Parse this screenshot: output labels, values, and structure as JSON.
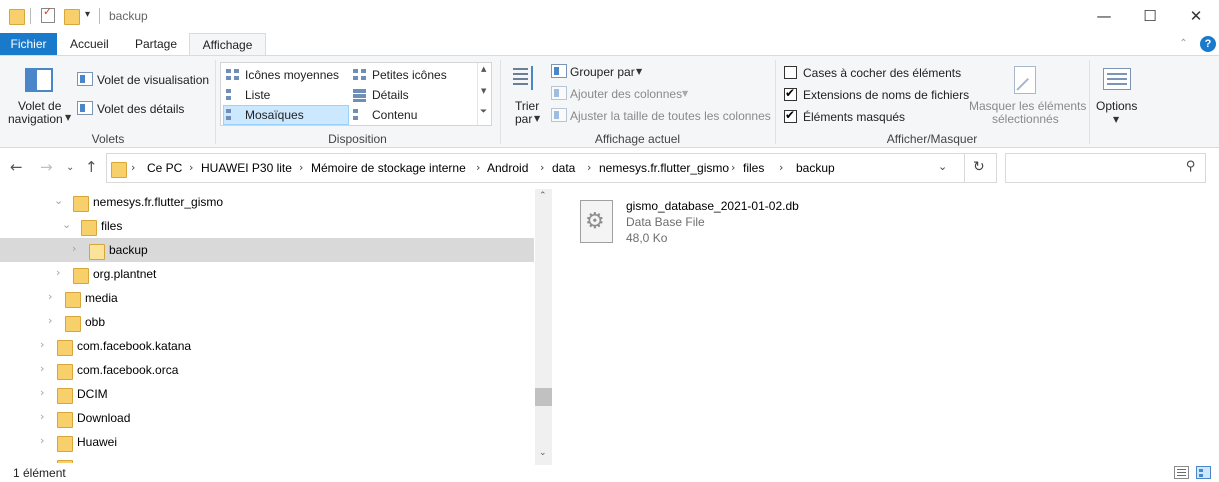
{
  "titlebar": {
    "title": "backup",
    "qat_dropdown": "▾",
    "minimize": "—",
    "maximize": "☐",
    "close": "✕"
  },
  "menu": {
    "tabs": [
      "Fichier",
      "Accueil",
      "Partage",
      "Affichage"
    ],
    "active": "Affichage",
    "help": "?"
  },
  "ribbon": {
    "volets": {
      "nav_pane_line1": "Volet de",
      "nav_pane_line2": "navigation",
      "preview": "Volet de visualisation",
      "details": "Volet des détails",
      "group": "Volets"
    },
    "disposition": {
      "items": [
        "Icônes moyennes",
        "Petites icônes",
        "Liste",
        "Détails",
        "Mosaïques",
        "Contenu"
      ],
      "selected": "Mosaïques",
      "group": "Disposition"
    },
    "affichage_actuel": {
      "sort_line1": "Trier",
      "sort_line2": "par",
      "group_by": "Grouper par",
      "add_columns": "Ajouter des colonnes",
      "fit_columns": "Ajuster la taille de toutes les colonnes",
      "group": "Affichage actuel"
    },
    "afficher_masquer": {
      "checkboxes": [
        {
          "label": "Cases à cocher des éléments",
          "checked": false
        },
        {
          "label": "Extensions de noms de fichiers",
          "checked": true
        },
        {
          "label": "Éléments masqués",
          "checked": true
        }
      ],
      "hide_selected_line1": "Masquer les éléments",
      "hide_selected_line2": "sélectionnés",
      "group": "Afficher/Masquer"
    },
    "options": "Options"
  },
  "address": {
    "crumbs": [
      "Ce PC",
      "HUAWEI P30 lite",
      "Mémoire de stockage interne",
      "Android",
      "data",
      "nemesys.fr.flutter_gismo",
      "files",
      "backup"
    ]
  },
  "tree": [
    {
      "label": "nemesys.fr.flutter_gismo",
      "expanded": true
    },
    {
      "label": "files",
      "expanded": true
    },
    {
      "label": "backup",
      "selected": true
    },
    {
      "label": "org.plantnet"
    },
    {
      "label": "media"
    },
    {
      "label": "obb"
    },
    {
      "label": "com.facebook.katana"
    },
    {
      "label": "com.facebook.orca"
    },
    {
      "label": "DCIM"
    },
    {
      "label": "Download"
    },
    {
      "label": "Huawei"
    }
  ],
  "files": [
    {
      "name": "gismo_database_2021-01-02.db",
      "type": "Data Base File",
      "size": "48,0 Ko"
    }
  ],
  "status": {
    "count": "1 élément"
  },
  "colors": {
    "accent": "#1979ca",
    "selection": "#d9d9d9",
    "ribbon_bg": "#f5f6f7",
    "folder": "#f7d06b"
  }
}
